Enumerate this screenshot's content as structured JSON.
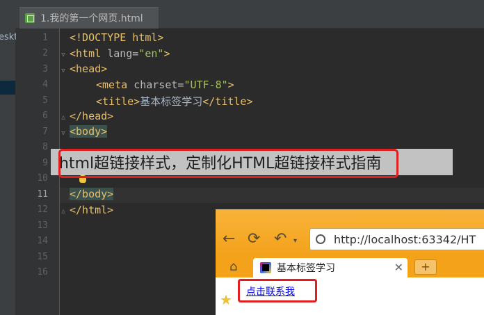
{
  "left_panel": {
    "partial_label": "eskt"
  },
  "editor_tab": {
    "title": "1.我的第一个网页.html",
    "icon": "html-file-icon"
  },
  "line_numbers": [
    "1",
    "2",
    "3",
    "4",
    "5",
    "6",
    "7",
    "8",
    "9",
    "10",
    "11",
    "12",
    "13",
    "14",
    "15",
    "16"
  ],
  "active_line": "11",
  "code": {
    "l1": "<!DOCTYPE html>",
    "l2_open": "<html ",
    "l2_attr": "lang=",
    "l2_val": "\"en\"",
    "l2_close": ">",
    "l3": "<head>",
    "l4_open": "<meta ",
    "l4_attr": "charset=",
    "l4_val": "\"UTF-8\"",
    "l4_close": ">",
    "l5_open": "<title>",
    "l5_text": "基本标签学习",
    "l5_close": "</title>",
    "l6": "</head>",
    "l7": "<body>",
    "l11": "</body>",
    "l12": "</html>"
  },
  "caption": "html超链接样式，定制化HTML超链接样式指南",
  "browser": {
    "url": "http://localhost:63342/HT",
    "tab_title": "基本标签学习",
    "tab_close": "✕",
    "new_tab": "+",
    "back_icon": "←",
    "reload_icon": "⟳",
    "undo_icon": "↶",
    "home_icon": "⌂",
    "link_text": "点击联系我",
    "star_icon": "★"
  },
  "colors": {
    "tag": "#e8bf6a",
    "attr_value": "#a5c25c",
    "highlight": "#e02020",
    "browser_chrome": "#f5a623"
  }
}
